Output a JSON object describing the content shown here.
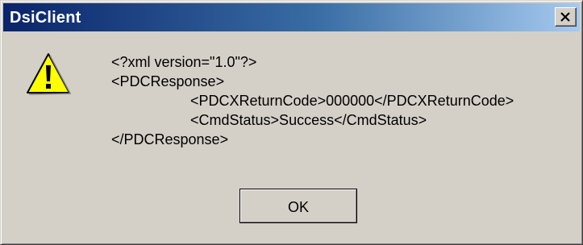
{
  "window": {
    "title": "DsiClient"
  },
  "dialog": {
    "icon": "warning-icon",
    "message_lines": [
      "<?xml version=\"1.0\"?>",
      "<PDCResponse>",
      "<PDCXReturnCode>000000</PDCXReturnCode>",
      "<CmdStatus>Success</CmdStatus>",
      "</PDCResponse>"
    ],
    "ok_label": "OK"
  },
  "colors": {
    "titlebar_start": "#0a246a",
    "titlebar_end": "#a6caf0",
    "face": "#d4d0c8",
    "warning_fill": "#ffff00"
  }
}
